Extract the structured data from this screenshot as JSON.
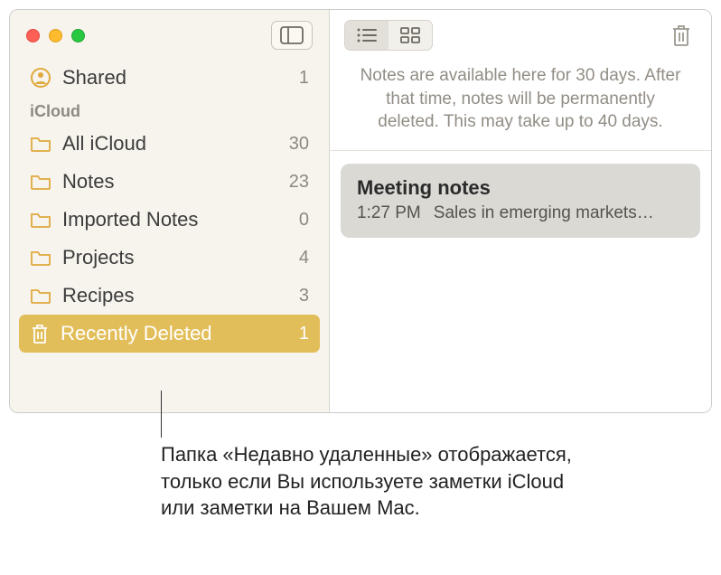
{
  "sidebar": {
    "shared": {
      "label": "Shared",
      "count": "1"
    },
    "section_label": "iCloud",
    "folders": [
      {
        "label": "All iCloud",
        "count": "30"
      },
      {
        "label": "Notes",
        "count": "23"
      },
      {
        "label": "Imported Notes",
        "count": "0"
      },
      {
        "label": "Projects",
        "count": "4"
      },
      {
        "label": "Recipes",
        "count": "3"
      },
      {
        "label": "Recently Deleted",
        "count": "1"
      }
    ]
  },
  "main": {
    "banner": "Notes are available here for 30 days. After that time, notes will be permanently deleted. This may take up to 40 days.",
    "note": {
      "title": "Meeting notes",
      "time": "1:27 PM",
      "preview": "Sales in emerging markets…"
    }
  },
  "caption": "Папка «Недавно удаленные» отображается, только если Вы используете заметки iCloud или заметки на Вашем Mac."
}
